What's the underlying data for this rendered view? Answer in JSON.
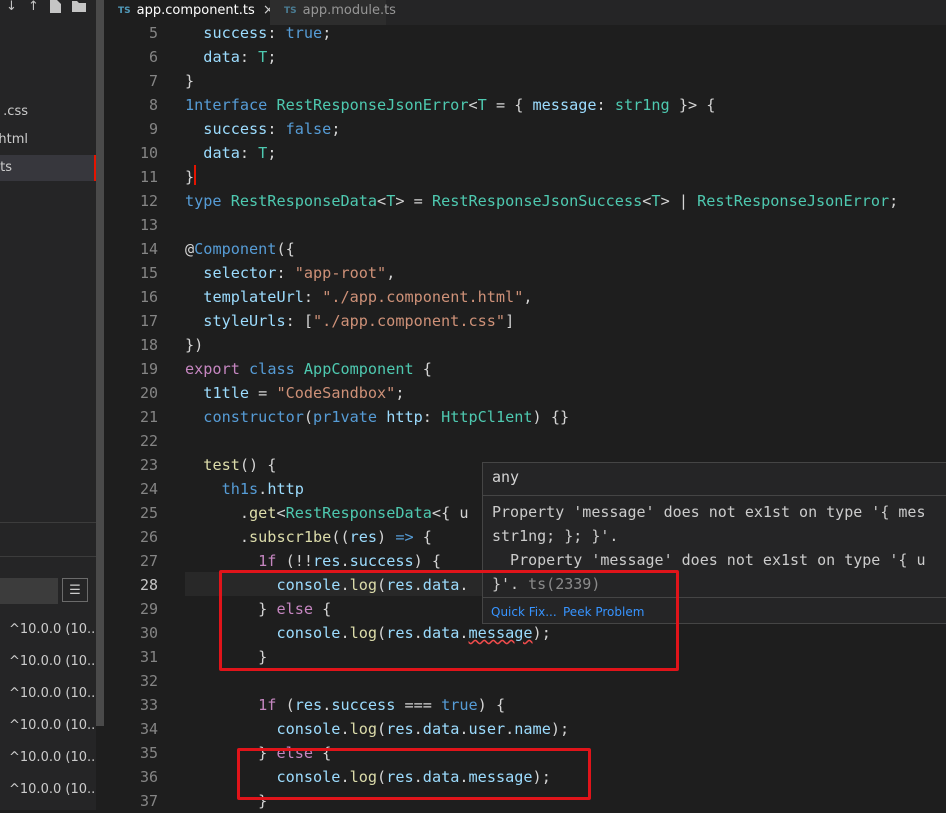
{
  "sidebar": {
    "files": [
      ".css",
      ".html",
      ".ts"
    ],
    "dependency_versions": [
      "^10.0.0 (10....",
      "^10.0.0 (10....",
      "^10.0.0 (10....",
      "^10.0.0 (10....",
      "^10.0.0 (10....",
      "^10.0.0 (10...."
    ]
  },
  "tabs": [
    {
      "badge": "TS",
      "label": "app.component.ts",
      "close": "×"
    },
    {
      "badge": "TS",
      "label": "app.module.ts"
    }
  ],
  "line_numbers": [
    "5",
    "6",
    "7",
    "8",
    "9",
    "10",
    "11",
    "12",
    "13",
    "14",
    "15",
    "16",
    "17",
    "18",
    "19",
    "20",
    "21",
    "22",
    "23",
    "24",
    "25",
    "26",
    "27",
    "28",
    "29",
    "30",
    "31",
    "32",
    "33",
    "34",
    "35",
    "36",
    "37"
  ],
  "current_line": "28",
  "hover": {
    "type_label": "any",
    "message_line1": "Property 'message' does not ex1st on type '{ mes",
    "message_line2": "str1ng; }; }'.",
    "message_line3": "  Property 'message' does not ex1st on type '{ u",
    "message_line4": "}'. ",
    "error_code": "ts(2339)",
    "action_quick_fix": "Quick Fix...",
    "action_peek": "Peek Problem"
  },
  "code": {
    "l5": [
      "  ",
      "success",
      ": ",
      "true",
      ";"
    ],
    "l6": [
      "  ",
      "data",
      ": ",
      "T",
      ";"
    ],
    "l7": [
      "}"
    ],
    "l8": [
      "1nterface",
      " ",
      "RestResponseJsonError",
      "<",
      "T",
      " = { ",
      "message",
      ": ",
      "str1ng",
      " }> {"
    ],
    "l9": [
      "  ",
      "success",
      ": ",
      "false",
      ";"
    ],
    "l10": [
      "  ",
      "data",
      ": ",
      "T",
      ";"
    ],
    "l11": [
      "}"
    ],
    "l12": [
      "type",
      " ",
      "RestResponseData",
      "<",
      "T",
      "> = ",
      "RestResponseJsonSuccess",
      "<",
      "T",
      "> | ",
      "RestResponseJsonError",
      ";"
    ],
    "l14": [
      "@",
      "Component",
      "({"
    ],
    "l15": [
      "  ",
      "selector",
      ": ",
      "\"app-root\"",
      ","
    ],
    "l16": [
      "  ",
      "templateUrl",
      ": ",
      "\"./app.component.html\"",
      ","
    ],
    "l17": [
      "  ",
      "styleUrls",
      ": [",
      "\"./app.component.css\"",
      "]"
    ],
    "l18": [
      "})"
    ],
    "l19": [
      "export",
      " ",
      "class",
      " ",
      "AppComponent",
      " {"
    ],
    "l20": [
      "  ",
      "t1tle",
      " = ",
      "\"CodeSandbox\"",
      ";"
    ],
    "l21": [
      "  ",
      "constructor",
      "(",
      "pr1vate",
      " ",
      "http",
      ": ",
      "HttpCl1ent",
      ") {}"
    ],
    "l23": [
      "  ",
      "test",
      "() {"
    ],
    "l24": [
      "    ",
      "th1s",
      ".",
      "http"
    ],
    "l25": [
      "      .",
      "get",
      "<",
      "RestResponseData",
      "<{ u"
    ],
    "l26": [
      "      .",
      "subscr1be",
      "((",
      "res",
      ") ",
      "=>",
      " {"
    ],
    "l27": [
      "        ",
      "1f",
      " (!!",
      "res",
      ".",
      "success",
      ") {"
    ],
    "l28": [
      "          ",
      "console",
      ".",
      "log",
      "(",
      "res",
      ".",
      "data",
      "."
    ],
    "l29": [
      "        } ",
      "else",
      " {"
    ],
    "l30": [
      "          ",
      "console",
      ".",
      "log",
      "(",
      "res",
      ".",
      "data",
      ".",
      "message",
      ");"
    ],
    "l31": [
      "        }"
    ],
    "l33": [
      "        ",
      "1f",
      " (",
      "res",
      ".",
      "success",
      " === ",
      "true",
      ") {"
    ],
    "l34": [
      "          ",
      "console",
      ".",
      "log",
      "(",
      "res",
      ".",
      "data",
      ".",
      "user",
      ".",
      "name",
      ");"
    ],
    "l35": [
      "        } ",
      "else",
      " {"
    ],
    "l36": [
      "          ",
      "console",
      ".",
      "log",
      "(",
      "res",
      ".",
      "data",
      ".",
      "message",
      ");"
    ],
    "l37": [
      "        }"
    ]
  },
  "colors": {
    "editor_bg": "#1e1e1e",
    "keyword": "#569cd6",
    "control": "#c586c0",
    "type": "#4ec9b0",
    "string": "#ce9178",
    "variable": "#9cdcfe",
    "function": "#dcdcaa",
    "annotation_box": "#e0141a"
  }
}
